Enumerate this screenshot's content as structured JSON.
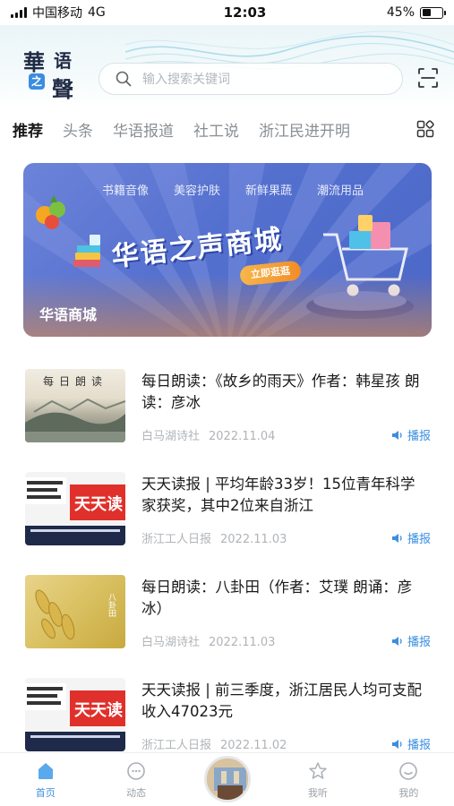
{
  "status_bar": {
    "carrier": "中国移动",
    "network": "4G",
    "time": "12:03",
    "battery_percent": "45%",
    "battery_level": 0.45
  },
  "header": {
    "logo_chars": [
      "華",
      "语",
      "之",
      "聲"
    ],
    "search_placeholder": "输入搜索关键词"
  },
  "tabs": [
    "推荐",
    "头条",
    "华语报道",
    "社工说",
    "浙江民进开明"
  ],
  "banner": {
    "categories": [
      "书籍音像",
      "美容护肤",
      "新鲜果蔬",
      "潮流用品"
    ],
    "title": "华语之声商城",
    "cta": "立即逛逛",
    "label": "华语商城"
  },
  "news": [
    {
      "title": "每日朗读：《故乡的雨天》作者：韩星孩 朗读：彦冰",
      "source": "白马湖诗社",
      "date": "2022.11.04",
      "action": "播报",
      "thumb_text": "每日朗读"
    },
    {
      "title": "天天读报 | 平均年龄33岁！15位青年科学家获奖，其中2位来自浙江",
      "source": "浙江工人日报",
      "date": "2022.11.03",
      "action": "播报",
      "thumb_text": "天天读"
    },
    {
      "title": "每日朗读：八卦田（作者：艾璞 朗诵：彦冰）",
      "source": "白马湖诗社",
      "date": "2022.11.03",
      "action": "播报",
      "thumb_text": "八卦田"
    },
    {
      "title": "天天读报 | 前三季度，浙江居民人均可支配收入47023元",
      "source": "浙江工人日报",
      "date": "2022.11.02",
      "action": "播报",
      "thumb_text": "天天读"
    }
  ],
  "tabbar": [
    "首页",
    "动态",
    "我听",
    "我的"
  ],
  "colors": {
    "accent": "#3c8fe0",
    "banner": "#5470cf",
    "cta": "#f28c28"
  }
}
